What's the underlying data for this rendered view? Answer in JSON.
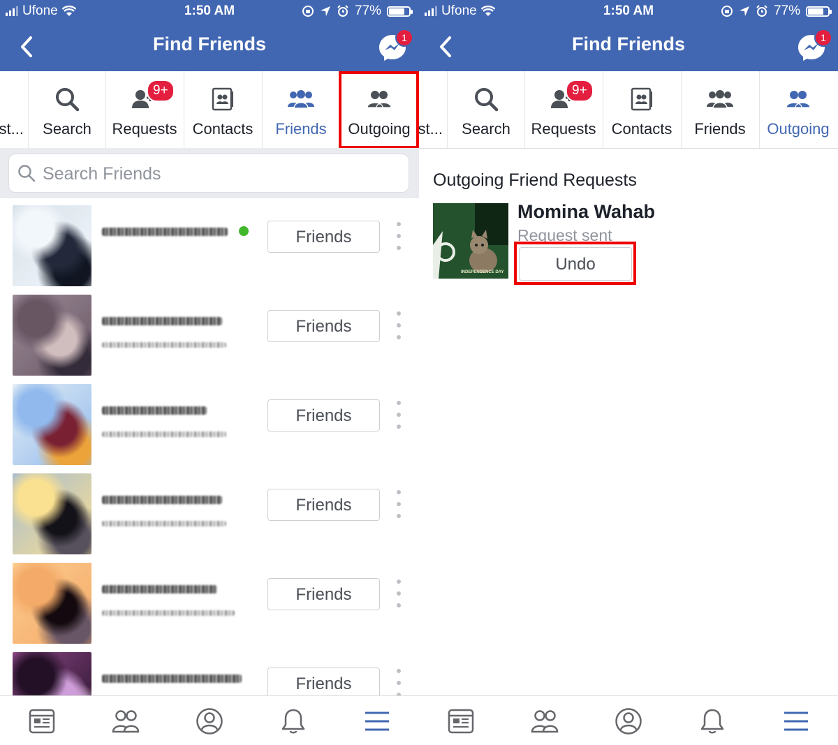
{
  "status_bar": {
    "carrier": "Ufone",
    "time": "1:50 AM",
    "battery": "77%"
  },
  "header": {
    "title": "Find Friends",
    "messenger_badge": "1"
  },
  "tabs": {
    "truncated": "st...",
    "search": "Search",
    "requests": "Requests",
    "requests_badge": "9+",
    "contacts": "Contacts",
    "friends": "Friends",
    "outgoing": "Outgoing"
  },
  "search": {
    "placeholder": "Search Friends"
  },
  "friend_list": {
    "button_label": "Friends",
    "rows": [
      {
        "online": true,
        "avatar_colors": [
          "#e8ecf0",
          "#2b3140",
          "#1a1f2a",
          "#cfd8e0"
        ]
      },
      {
        "online": false,
        "avatar_colors": [
          "#6a5a66",
          "#c9b7b8",
          "#3b3340",
          "#9a8a96"
        ]
      },
      {
        "online": false,
        "avatar_colors": [
          "#8fb4e3",
          "#7a2a3a",
          "#e2a040",
          "#dbe4ea"
        ]
      },
      {
        "online": false,
        "avatar_colors": [
          "#efd890",
          "#1e1c22",
          "#5a5560",
          "#a3b5c8"
        ]
      },
      {
        "online": false,
        "avatar_colors": [
          "#e9a66a",
          "#1d1418",
          "#6a5a68",
          "#f1c58e"
        ]
      },
      {
        "online": false,
        "avatar_colors": [
          "#2b1a2e",
          "#c79ad1",
          "#e7c7e8",
          "#8a4c85"
        ]
      }
    ]
  },
  "outgoing": {
    "section_title": "Outgoing Friend Requests",
    "person_name": "Momina Wahab",
    "status": "Request sent",
    "undo_label": "Undo",
    "photo_caption": "INDEPENDENCE DAY"
  },
  "bottom_nav": [
    "news-feed-icon",
    "friends-icon",
    "profile-icon",
    "notifications-icon",
    "menu-icon"
  ],
  "colors": {
    "brand": "#4267b2",
    "badge": "#e41e3f",
    "highlight": "#ee0000",
    "online": "#42b72a"
  }
}
